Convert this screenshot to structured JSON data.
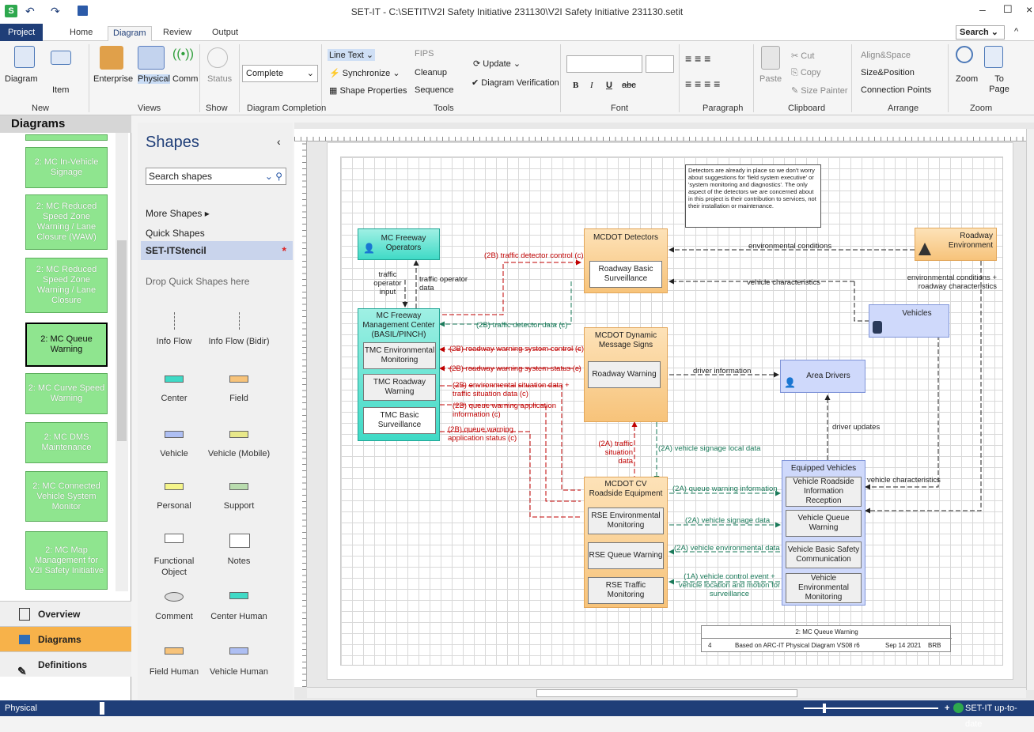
{
  "window": {
    "title": "SET-IT - C:\\SETIT\\V2I Safety Initiative 231130\\V2I Safety Initiative 231130.setit"
  },
  "tabs": [
    "Project",
    "Home",
    "Diagram",
    "Review",
    "Output"
  ],
  "search_label": "Search",
  "ribbon": {
    "new": {
      "diagram": "Diagram",
      "item": "Item",
      "group": "New"
    },
    "views": {
      "enterprise": "Enterprise",
      "physical": "Physical",
      "comm": "Comm",
      "group": "Views"
    },
    "show": {
      "status": "Status",
      "group": "Show"
    },
    "completion": {
      "value": "Complete",
      "group": "Diagram Completion"
    },
    "tools": {
      "line_text": "Line Text",
      "synchronize": "Synchronize",
      "shape_properties": "Shape Properties",
      "fips": "FIPS",
      "cleanup": "Cleanup",
      "sequence": "Sequence",
      "update": "Update",
      "verification": "Diagram Verification",
      "group": "Tools"
    },
    "font": {
      "group": "Font",
      "bold": "B",
      "italic": "I",
      "underline": "U",
      "strike": "abc"
    },
    "paragraph": {
      "group": "Paragraph"
    },
    "clipboard": {
      "paste": "Paste",
      "cut": "Cut",
      "copy": "Copy",
      "size_painter": "Size Painter",
      "group": "Clipboard"
    },
    "arrange": {
      "align": "Align&Space",
      "size_pos": "Size&Position",
      "conn": "Connection Points",
      "group": "Arrange"
    },
    "zoom": {
      "zoom": "Zoom",
      "to_page": "To Page",
      "group": "Zoom"
    }
  },
  "left": {
    "header": "Diagrams",
    "items": [
      "2: MC In-Vehicle Signage",
      "2: MC Reduced Speed Zone Warning / Lane Closure (WAW)",
      "2: MC Reduced Speed Zone Warning / Lane Closure",
      "2: MC Queue Warning",
      "2: MC Curve Speed Warning",
      "2: MC DMS Maintenance",
      "2: MC Connected Vehicle System Monitor",
      "2: MC Map Management for V2I Safety Initiative"
    ],
    "nav": [
      "Overview",
      "Diagrams",
      "Definitions"
    ]
  },
  "shapes": {
    "title": "Shapes",
    "search": "Search shapes",
    "more": "More Shapes",
    "quick": "Quick Shapes",
    "stencil": "SET-ITStencil",
    "drop": "Drop Quick Shapes here",
    "items": [
      "Info Flow",
      "Info Flow (Bidir)",
      "Center",
      "Field",
      "Vehicle",
      "Vehicle (Mobile)",
      "Personal",
      "Support",
      "Functional Object",
      "Notes",
      "Comment",
      "Center Human",
      "Field Human",
      "Vehicle Human"
    ]
  },
  "diagram": {
    "note": "Detectors are already in place so we don't worry about suggestions for 'field system executive' or 'system monitoring and diagnostics'. The only aspect of the detectors we are concerned about in this project is their contribution to services, not their installation or maintenance.",
    "mc_operators": "MC Freeway Operators",
    "mc_center": "MC Freeway Management Center (BASIL/PINCH)",
    "tmc_env": "TMC Environmental Monitoring",
    "tmc_rw": "TMC Roadway Warning",
    "tmc_basic": "TMC Basic Surveillance",
    "detectors": "MCDOT Detectors",
    "rbs": "Roadway Basic Surveillance",
    "dms": "MCDOT Dynamic Message Signs",
    "rw": "Roadway Warning",
    "rse": "MCDOT CV Roadside Equipment",
    "rse_env": "RSE Environmental Monitoring",
    "rse_qw": "RSE Queue Warning",
    "rse_tm": "RSE Traffic Monitoring",
    "roadway_env": "Roadway Environment",
    "vehicles": "Vehicles",
    "area_drivers": "Area Drivers",
    "equipped": "Equipped Vehicles",
    "vrir": "Vehicle Roadside Information Reception",
    "vqw": "Vehicle Queue Warning",
    "vbsc": "Vehicle Basic Safety Communication",
    "vem": "Vehicle Environmental Monitoring",
    "flows": {
      "toi": "traffic operator input",
      "tod": "traffic operator data",
      "tdc": "(2B) traffic detector control (c)",
      "tdd": "(2B) traffic detector data (c)",
      "env": "environmental conditions",
      "vc": "vehicle characteristics",
      "envrc": "environmental conditions + roadway characteristics",
      "rwsc": "(2B) roadway warning system control (c)",
      "rwss": "(2B) roadway warning system status (c)",
      "esd": "(2B) environmental situation data + traffic situation data (c)",
      "qwai": "(2B) queue warning application information (c)",
      "qwas": "(2B) queue warning application status (c)",
      "di": "driver information",
      "du": "driver updates",
      "tsd": "(2A) traffic situation data",
      "vsld": "(2A) vehicle signage local data",
      "qwi": "(2A) queue warning information",
      "vsd": "(2A) vehicle signage data",
      "ved": "(2A) vehicle environmental data",
      "vce": "(1A) vehicle control event + vehicle location and motion for surveillance",
      "vc2": "vehicle characteristics"
    },
    "footer": {
      "title": "2: MC Queue Warning",
      "num": "4",
      "based": "Based on ARC-IT Physical Diagram VS08 r6",
      "date": "Sep 14 2021",
      "by": "BRB"
    }
  },
  "status": {
    "left": "Physical",
    "right": "SET-IT up-to-date"
  }
}
